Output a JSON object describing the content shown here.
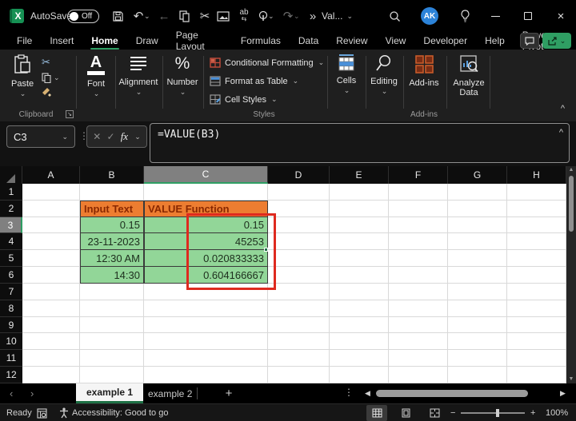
{
  "window": {
    "title": "Val...",
    "autosave_label": "AutoSave",
    "autosave_state": "Off",
    "avatar": "AK",
    "overflow_glyph": "»"
  },
  "ribbon_tabs": [
    "File",
    "Insert",
    "Home",
    "Draw",
    "Page Layout",
    "Formulas",
    "Data",
    "Review",
    "View",
    "Developer",
    "Help",
    "Power Pivot"
  ],
  "active_tab": "Home",
  "ribbon": {
    "clipboard": {
      "paste": "Paste",
      "label": "Clipboard"
    },
    "font": {
      "button": "Font"
    },
    "alignment": {
      "button": "Alignment"
    },
    "number": {
      "button": "Number"
    },
    "styles": {
      "items": [
        "Conditional Formatting",
        "Format as Table",
        "Cell Styles"
      ],
      "label": "Styles"
    },
    "cells": {
      "button": "Cells"
    },
    "editing": {
      "button": "Editing"
    },
    "addins": {
      "button": "Add-ins",
      "label": "Add-ins"
    },
    "analyze": {
      "button": "Analyze Data"
    }
  },
  "formula_bar": {
    "name_box": "C3",
    "fx_label": "fx",
    "formula": "=VALUE(B3)"
  },
  "grid": {
    "columns": [
      "A",
      "B",
      "C",
      "D",
      "E",
      "F",
      "G",
      "H"
    ],
    "row_labels": [
      "1",
      "2",
      "3",
      "4",
      "5",
      "6",
      "7",
      "8",
      "9",
      "10",
      "11",
      "12"
    ],
    "selected_column": "C",
    "selected_row": "3",
    "cells": [
      {
        "ref": "B2",
        "text": "Input Text",
        "type": "header"
      },
      {
        "ref": "C2",
        "text": "VALUE Function",
        "type": "header"
      },
      {
        "ref": "B3",
        "text": "0.15",
        "type": "data"
      },
      {
        "ref": "C3",
        "text": "0.15",
        "type": "data"
      },
      {
        "ref": "B4",
        "text": "23-11-2023",
        "type": "data"
      },
      {
        "ref": "C4",
        "text": "45253",
        "type": "data"
      },
      {
        "ref": "B5",
        "text": "12:30 AM",
        "type": "data"
      },
      {
        "ref": "C5",
        "text": "0.020833333",
        "type": "data"
      },
      {
        "ref": "B6",
        "text": "14:30",
        "type": "data"
      },
      {
        "ref": "C6",
        "text": "0.604166667",
        "type": "data"
      }
    ],
    "colors": {
      "table_header_fill": "#ED7D31",
      "table_header_text": "#8A2800",
      "table_data_fill": "#92D698",
      "table_data_text": "#1d2e1d",
      "annotation_box": "#DE2A1F",
      "selection_accent": "#1E7145"
    }
  },
  "sheet_tabs": [
    {
      "label": "example 1",
      "active": true
    },
    {
      "label": "example 2",
      "active": false
    }
  ],
  "status_bar": {
    "mode": "Ready",
    "accessibility": "Accessibility: Good to go",
    "zoom_level": "100%"
  }
}
